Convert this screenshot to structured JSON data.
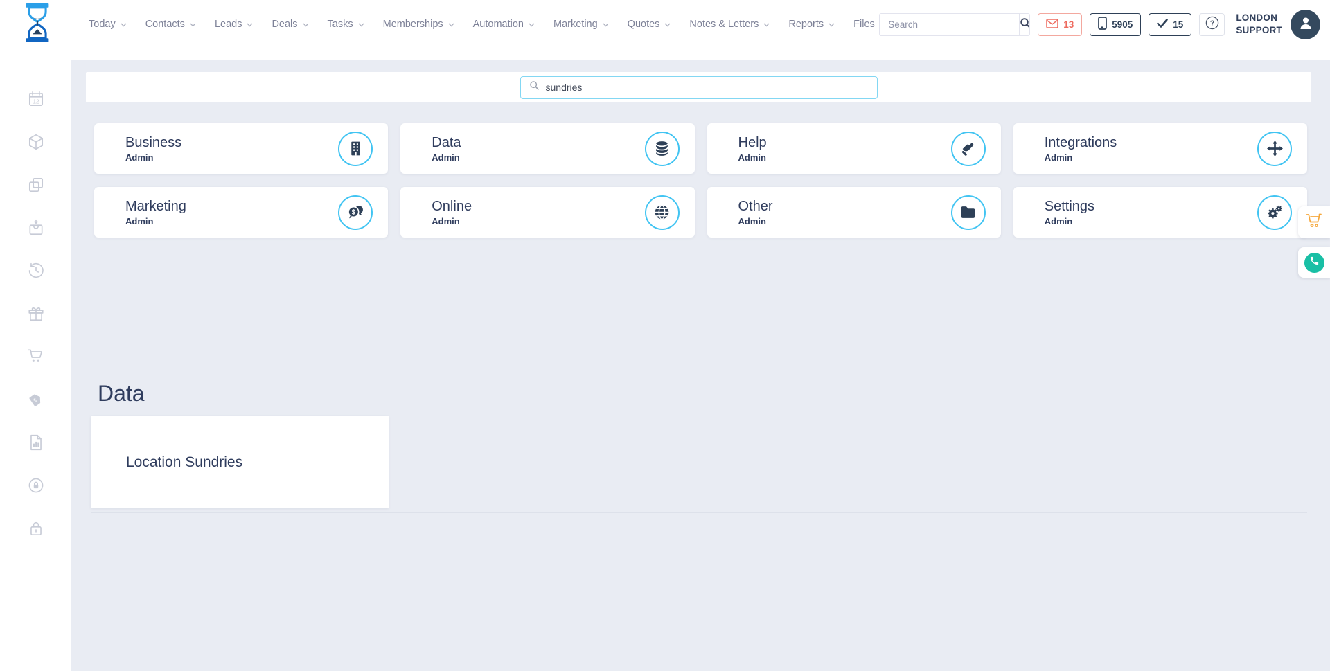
{
  "colors": {
    "accent_blue": "#41c4f2",
    "navy": "#2e4057",
    "alert_red": "#ed6a5e",
    "cart_orange": "#f6a83c",
    "chat_teal": "#19bfa5",
    "page_bg": "#e9ecf3"
  },
  "topnav": {
    "logo_icon": "hourglass-logo-icon",
    "items": [
      {
        "label": "Today",
        "dropdown": true
      },
      {
        "label": "Contacts",
        "dropdown": true
      },
      {
        "label": "Leads",
        "dropdown": true
      },
      {
        "label": "Deals",
        "dropdown": true
      },
      {
        "label": "Tasks",
        "dropdown": true
      },
      {
        "label": "Memberships",
        "dropdown": true
      },
      {
        "label": "Automation",
        "dropdown": true
      },
      {
        "label": "Marketing",
        "dropdown": true
      },
      {
        "label": "Quotes",
        "dropdown": true
      },
      {
        "label": "Notes & Letters",
        "dropdown": true
      },
      {
        "label": "Reports",
        "dropdown": true
      },
      {
        "label": "Files",
        "dropdown": false
      }
    ],
    "search": {
      "placeholder": "Search",
      "icon": "search-icon"
    },
    "badges": {
      "mail": {
        "count": "13",
        "icon": "envelope-icon"
      },
      "phone": {
        "count": "5905",
        "icon": "mobile-icon"
      },
      "tasks": {
        "count": "15",
        "icon": "check-icon"
      }
    },
    "help_icon": "question-circle-icon",
    "user": {
      "line1": "LONDON",
      "line2": "SUPPORT",
      "avatar_icon": "person-icon"
    }
  },
  "sidebar": {
    "icons": [
      "calendar-12-icon",
      "cube-icon",
      "clone-icon",
      "bag-import-icon",
      "history-icon",
      "gift-icon",
      "cart-icon",
      "price-tag-icon",
      "report-file-icon",
      "user-lock-circle-icon",
      "padlock-icon"
    ]
  },
  "main": {
    "module_search": {
      "value": "sundries",
      "icon": "search-icon"
    },
    "cards": [
      {
        "title": "Business",
        "subtitle": "Admin",
        "icon": "building-icon"
      },
      {
        "title": "Data",
        "subtitle": "Admin",
        "icon": "database-icon"
      },
      {
        "title": "Help",
        "subtitle": "Admin",
        "icon": "helping-hand-icon"
      },
      {
        "title": "Integrations",
        "subtitle": "Admin",
        "icon": "arrows-move-icon"
      },
      {
        "title": "Marketing",
        "subtitle": "Admin",
        "icon": "comments-dollar-icon"
      },
      {
        "title": "Online",
        "subtitle": "Admin",
        "icon": "globe-icon"
      },
      {
        "title": "Other",
        "subtitle": "Admin",
        "icon": "folder-icon"
      },
      {
        "title": "Settings",
        "subtitle": "Admin",
        "icon": "cogs-icon"
      }
    ],
    "results_section": {
      "heading": "Data",
      "items": [
        "Location Sundries"
      ]
    }
  },
  "floating": {
    "cart_icon": "shopping-cart-icon",
    "chat_icon": "phone-icon"
  }
}
